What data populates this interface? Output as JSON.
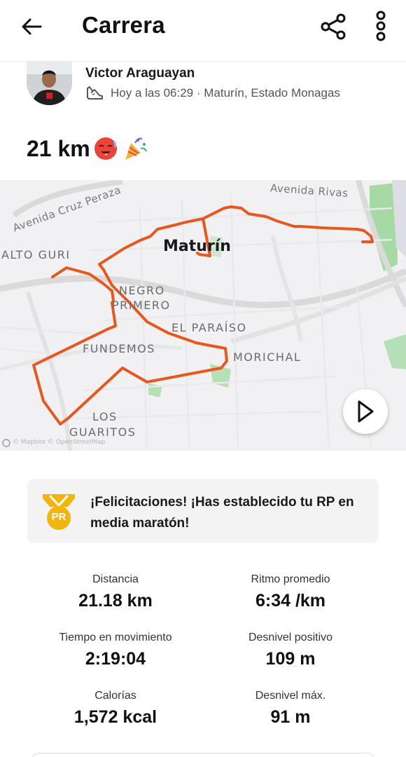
{
  "header": {
    "title": "Carrera",
    "back_icon": "arrow-left-icon",
    "share_icon": "share-icon",
    "more_icon": "more-vertical-icon"
  },
  "athlete": {
    "name": "Victor Araguayan",
    "meta": "Hoy a las 06:29 · Maturín, Estado Monagas",
    "activity_icon": "running-shoe-icon"
  },
  "activity": {
    "title": "21 km",
    "emojis": [
      "hot-face-emoji",
      "party-popper-emoji"
    ]
  },
  "map": {
    "city": "Maturín",
    "labels": {
      "avenida_cruz": "Avenida Cruz Peraza",
      "avenida_rivas": "Avenida Rivas",
      "alto_guri": "ALTO GURI",
      "negro": "NEGRO",
      "primero": "PRIMERO",
      "el_paraiso": "EL PARAÍSO",
      "fundemos": "FUNDEMOS",
      "morichal": "MORICHAL",
      "los": "LOS",
      "guaritos": "GUARITOS"
    },
    "attribution": "© Mapbox © OpenStreetMap",
    "route_color": "#e8571e",
    "play_icon": "play-icon"
  },
  "achievement": {
    "icon": "pr-medal-icon",
    "badge_text": "PR",
    "text": "¡Felicitaciones! ¡Has establecido tu RP en media maratón!",
    "color": "#f2b50f"
  },
  "stats": {
    "distance": {
      "label": "Distancia",
      "value": "21.18 km"
    },
    "pace": {
      "label": "Ritmo promedio",
      "value": "6:34 /km"
    },
    "moving_time": {
      "label": "Tiempo en movimiento",
      "value": "2:19:04"
    },
    "elevation_gain": {
      "label": "Desnivel positivo",
      "value": "109 m"
    },
    "calories": {
      "label": "Calorías",
      "value": "1,572 kcal"
    },
    "max_elevation": {
      "label": "Desnivel máx.",
      "value": "91 m"
    }
  }
}
